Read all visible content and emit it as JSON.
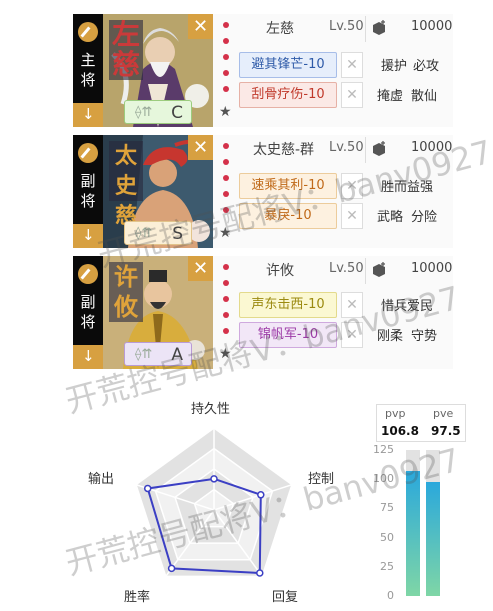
{
  "generals": [
    {
      "role": "主将",
      "name_plate": "左慈",
      "name": "左慈",
      "level": "Lv.50",
      "cost": "10000",
      "grade": "C",
      "skills": [
        "避其锋芒-10",
        "刮骨疗伤-10"
      ],
      "traits": [
        [
          "援护",
          "必攻"
        ],
        [
          "掩虚",
          "散仙"
        ]
      ]
    },
    {
      "role": "副将",
      "name_plate": "太史慈",
      "name": "太史慈-群",
      "level": "Lv.50",
      "cost": "10000",
      "grade": "S",
      "skills": [
        "速乘其利-10",
        "暴戾-10"
      ],
      "traits": [
        [
          "胜而益强"
        ],
        [
          "武略",
          "分险"
        ]
      ]
    },
    {
      "role": "副将",
      "name_plate": "许攸",
      "name": "许攸",
      "level": "Lv.50",
      "cost": "10000",
      "grade": "A",
      "skills": [
        "声东击西-10",
        "锦帆军-10"
      ],
      "traits": [
        [
          "惜兵爱民"
        ],
        [
          "刚柔",
          "守势"
        ]
      ]
    }
  ],
  "radar": {
    "axes": [
      "持久性",
      "控制",
      "回复",
      "胜率",
      "输出"
    ],
    "values": [
      0.38,
      0.6,
      0.95,
      0.88,
      0.85
    ]
  },
  "pvp_chart": {
    "y_ticks": [
      "125",
      "100",
      "75",
      "50",
      "25",
      "0"
    ],
    "ymax": 125,
    "pvp_label": "pvp",
    "pvp_value": "106.8",
    "pve_label": "pve",
    "pve_value": "97.5",
    "pvp": 106.8,
    "pve": 97.5
  },
  "watermark": [
    "开荒控号配将V：banv0927",
    "开荒控号配将V：banv0927",
    "开荒控号配将V：banv0927"
  ],
  "colors": {
    "accent_gold": "#d7a041",
    "dot_red": "#d4314a",
    "radar_line": "#3b3fc4",
    "bar_top": "#2aa8dc",
    "bar_bottom": "#7fd6a6"
  }
}
